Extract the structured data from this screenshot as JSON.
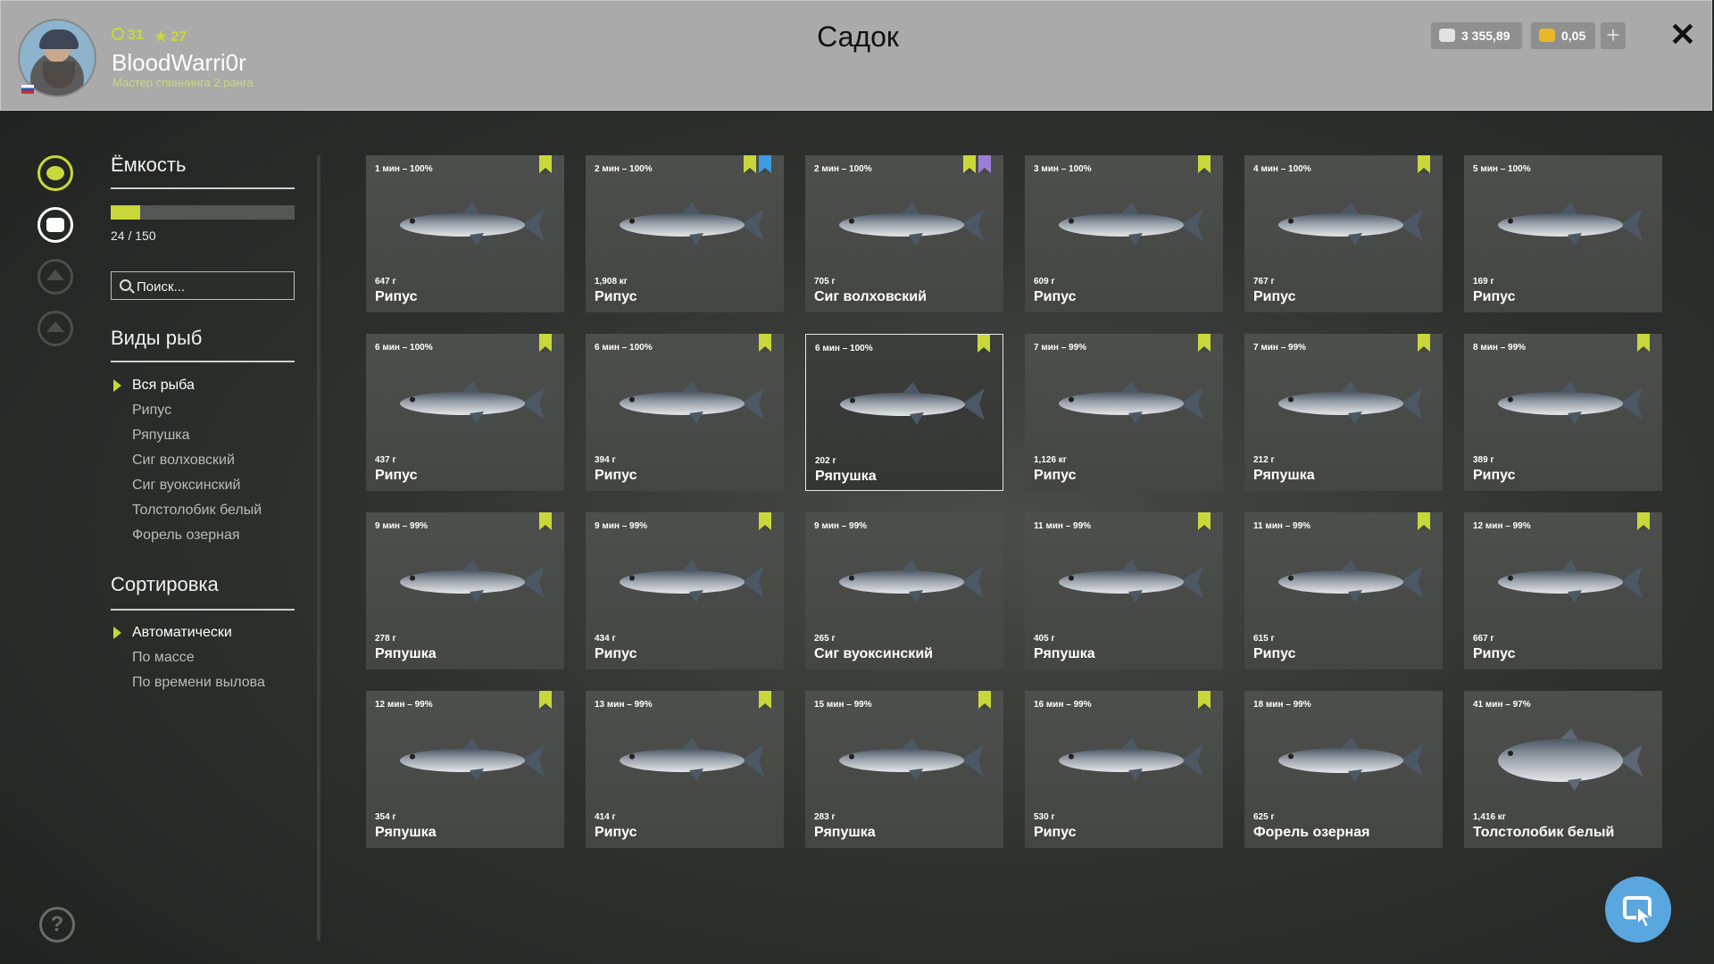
{
  "header": {
    "title": "Садок",
    "player": {
      "username": "BloodWarri0r",
      "rank": "Мастер спиннинга 2 ранга",
      "level": "31",
      "stars": "27"
    },
    "silver": "3 355,89",
    "gold": "0,05",
    "plus_label": "+",
    "close_label": "✕"
  },
  "colors": {
    "accent": "#c8d83a",
    "blue_accent": "#5aa7e0",
    "purple_mark": "#9a7fd8",
    "blue_mark": "#3d9be0"
  },
  "rail": [
    {
      "icon": "fish-icon",
      "state": "active"
    },
    {
      "icon": "keepnet-icon",
      "state": "white"
    },
    {
      "icon": "upgrade-icon",
      "state": "dim"
    },
    {
      "icon": "home-icon",
      "state": "dim"
    }
  ],
  "sidebar": {
    "capacity_title": "Ёмкость",
    "capacity_text": "24 / 150",
    "capacity_fraction": 0.16,
    "search_placeholder": "Поиск...",
    "species_title": "Виды рыб",
    "species": [
      "Вся рыба",
      "Рипус",
      "Ряпушка",
      "Сиг волховский",
      "Сиг вуоксинский",
      "Толстолобик белый",
      "Форель озерная"
    ],
    "species_selected": 0,
    "sort_title": "Сортировка",
    "sort": [
      "Автоматически",
      "По массе",
      "По времени вылова"
    ],
    "sort_selected": 0
  },
  "fish": [
    {
      "time": "1 мин – 100%",
      "weight": "647 г",
      "name": "Рипус",
      "marks": [
        "green"
      ]
    },
    {
      "time": "2 мин – 100%",
      "weight": "1,908 кг",
      "name": "Рипус",
      "marks": [
        "green",
        "blue"
      ]
    },
    {
      "time": "2 мин – 100%",
      "weight": "705 г",
      "name": "Сиг волховский",
      "marks": [
        "green",
        "purple"
      ]
    },
    {
      "time": "3 мин – 100%",
      "weight": "609 г",
      "name": "Рипус",
      "marks": [
        "green"
      ]
    },
    {
      "time": "4 мин – 100%",
      "weight": "767 г",
      "name": "Рипус",
      "marks": [
        "green"
      ]
    },
    {
      "time": "5 мин – 100%",
      "weight": "169 г",
      "name": "Рипус",
      "marks": []
    },
    {
      "time": "6 мин – 100%",
      "weight": "437 г",
      "name": "Рипус",
      "marks": [
        "green"
      ]
    },
    {
      "time": "6 мин – 100%",
      "weight": "394 г",
      "name": "Рипус",
      "marks": [
        "green"
      ]
    },
    {
      "time": "6 мин – 100%",
      "weight": "202 г",
      "name": "Ряпушка",
      "marks": [
        "green"
      ],
      "selected": true
    },
    {
      "time": "7 мин – 99%",
      "weight": "1,126 кг",
      "name": "Рипус",
      "marks": [
        "green"
      ]
    },
    {
      "time": "7 мин – 99%",
      "weight": "212 г",
      "name": "Ряпушка",
      "marks": [
        "green"
      ]
    },
    {
      "time": "8 мин – 99%",
      "weight": "389 г",
      "name": "Рипус",
      "marks": [
        "green"
      ]
    },
    {
      "time": "9 мин – 99%",
      "weight": "278 г",
      "name": "Ряпушка",
      "marks": [
        "green"
      ]
    },
    {
      "time": "9 мин – 99%",
      "weight": "434 г",
      "name": "Рипус",
      "marks": [
        "green"
      ]
    },
    {
      "time": "9 мин – 99%",
      "weight": "265 г",
      "name": "Сиг вуоксинский",
      "marks": []
    },
    {
      "time": "11 мин – 99%",
      "weight": "405 г",
      "name": "Ряпушка",
      "marks": [
        "green"
      ]
    },
    {
      "time": "11 мин – 99%",
      "weight": "615 г",
      "name": "Рипус",
      "marks": [
        "green"
      ]
    },
    {
      "time": "12 мин – 99%",
      "weight": "667 г",
      "name": "Рипус",
      "marks": [
        "green"
      ]
    },
    {
      "time": "12 мин – 99%",
      "weight": "354 г",
      "name": "Ряпушка",
      "marks": [
        "green"
      ]
    },
    {
      "time": "13 мин – 99%",
      "weight": "414 г",
      "name": "Рипус",
      "marks": [
        "green"
      ]
    },
    {
      "time": "15 мин – 99%",
      "weight": "283 г",
      "name": "Ряпушка",
      "marks": [
        "green"
      ]
    },
    {
      "time": "16 мин – 99%",
      "weight": "530 г",
      "name": "Рипус",
      "marks": [
        "green"
      ]
    },
    {
      "time": "18 мин – 99%",
      "weight": "625 г",
      "name": "Форель озерная",
      "marks": []
    },
    {
      "time": "41 мин – 97%",
      "weight": "1,416 кг",
      "name": "Толстолобик белый",
      "marks": []
    }
  ],
  "help_label": "?"
}
